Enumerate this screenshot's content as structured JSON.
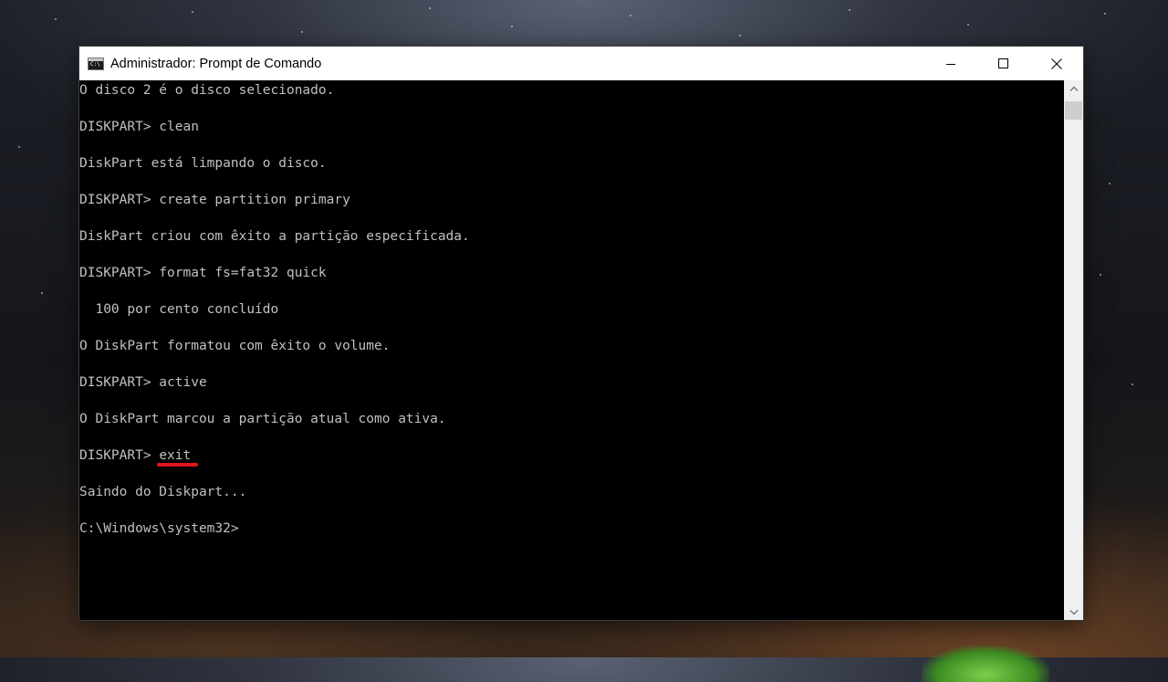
{
  "window": {
    "title": "Administrador: Prompt de Comando",
    "icon": "cmd-icon",
    "controls": [
      "minimize-icon",
      "maximize-icon",
      "close-icon"
    ]
  },
  "console": {
    "lines": [
      "O disco 2 é o disco selecionado.",
      "DISKPART> clean",
      "DiskPart está limpando o disco.",
      "DISKPART> create partition primary",
      "DiskPart criou com êxito a partição especificada.",
      "DISKPART> format fs=fat32 quick",
      "  100 por cento concluído",
      "O DiskPart formatou com êxito o volume.",
      "DISKPART> active",
      "O DiskPart marcou a partição atual como ativa.",
      "DISKPART> ",
      "Saindo do Diskpart...",
      "C:\\Windows\\system32>"
    ],
    "highlighted_command": "exit",
    "highlight_color": "#e0141e",
    "text_color": "#c0c0c0",
    "background": "#000000"
  }
}
